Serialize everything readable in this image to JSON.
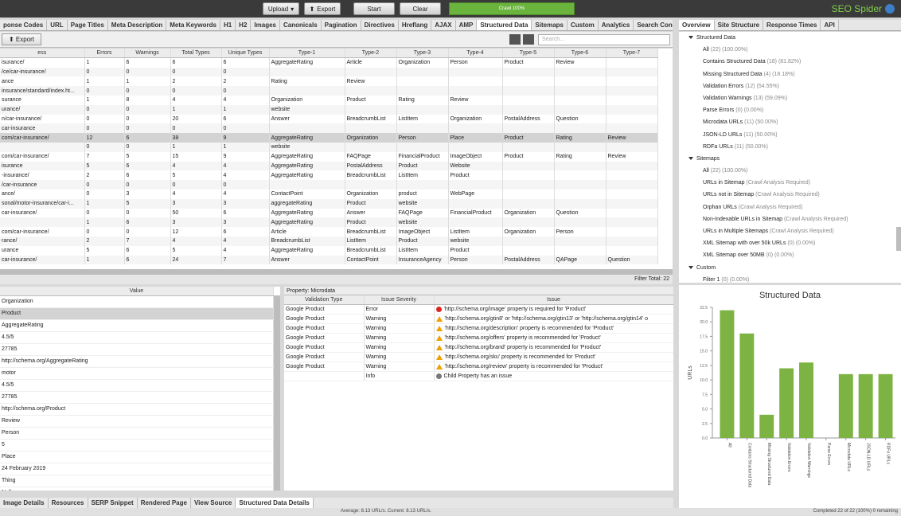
{
  "topbar": {
    "upload_label": "Upload",
    "export_label": "Export",
    "start_label": "Start",
    "clear_label": "Clear",
    "progress_text": "Crawl 100%",
    "progress_value": 100,
    "brand": "SEO Spider"
  },
  "top_tabs": [
    "ponse Codes",
    "URL",
    "Page Titles",
    "Meta Description",
    "Meta Keywords",
    "H1",
    "H2",
    "Images",
    "Canonicals",
    "Pagination",
    "Directives",
    "Hreflang",
    "AJAX",
    "AMP",
    "Structured Data",
    "Sitemaps",
    "Custom",
    "Analytics",
    "Search Con"
  ],
  "active_top_tab": "Structured Data",
  "toolbar": {
    "export_label": "Export",
    "search_placeholder": "Search..."
  },
  "grid": {
    "columns": [
      "ess",
      "Errors",
      "Warnings",
      "Total Types",
      "Unique Types",
      "Type-1",
      "Type-2",
      "Type-3",
      "Type-4",
      "Type-5",
      "Type-6",
      "Type-7"
    ],
    "rows": [
      [
        "isurance/",
        "1",
        "6",
        "6",
        "6",
        "AggregateRating",
        "Article",
        "Organization",
        "Person",
        "Product",
        "Review",
        ""
      ],
      [
        "/ce/car-insurance/",
        "0",
        "0",
        "0",
        "0",
        "",
        "",
        "",
        "",
        "",
        "",
        ""
      ],
      [
        "ance",
        "1",
        "1",
        "2",
        "2",
        "Rating",
        "Review",
        "",
        "",
        "",
        "",
        ""
      ],
      [
        "insurance/standard/index.ht...",
        "0",
        "0",
        "0",
        "0",
        "",
        "",
        "",
        "",
        "",
        "",
        ""
      ],
      [
        "surance",
        "1",
        "8",
        "4",
        "4",
        "Organization",
        "Product",
        "Rating",
        "Review",
        "",
        "",
        ""
      ],
      [
        "urance/",
        "0",
        "0",
        "1",
        "1",
        "website",
        "",
        "",
        "",
        "",
        "",
        ""
      ],
      [
        "n/car-insurance/",
        "0",
        "0",
        "20",
        "6",
        "Answer",
        "BreadcrumbList",
        "ListItem",
        "Organization",
        "PostalAddress",
        "Question",
        ""
      ],
      [
        "car-insurance",
        "0",
        "0",
        "0",
        "0",
        "",
        "",
        "",
        "",
        "",
        "",
        ""
      ],
      [
        "com/car-insurance/",
        "12",
        "6",
        "38",
        "9",
        "AggregateRating",
        "Organization",
        "Person",
        "Place",
        "Product",
        "Rating",
        "Review"
      ],
      [
        "",
        "0",
        "0",
        "1",
        "1",
        "website",
        "",
        "",
        "",
        "",
        "",
        ""
      ],
      [
        "com/car-insurance/",
        "7",
        "5",
        "15",
        "9",
        "AggregateRating",
        "FAQPage",
        "FinancialProduct",
        "ImageObject",
        "Product",
        "Rating",
        "Review"
      ],
      [
        "isurance",
        "5",
        "6",
        "4",
        "4",
        "AggregateRating",
        "PostalAddress",
        "Product",
        "Website",
        "",
        "",
        ""
      ],
      [
        "-insurance/",
        "2",
        "6",
        "5",
        "4",
        "AggregateRating",
        "BreadcrumbList",
        "ListItem",
        "Product",
        "",
        "",
        ""
      ],
      [
        "/car-insurance",
        "0",
        "0",
        "0",
        "0",
        "",
        "",
        "",
        "",
        "",
        "",
        ""
      ],
      [
        "ance/",
        "0",
        "3",
        "4",
        "4",
        "ContactPoint",
        "Organization",
        "product",
        "WebPage",
        "",
        "",
        ""
      ],
      [
        "sonal/motor-insurance/car-i...",
        "1",
        "5",
        "3",
        "3",
        "aggregateRating",
        "Product",
        "website",
        "",
        "",
        "",
        ""
      ],
      [
        "car-insurance/",
        "0",
        "0",
        "50",
        "6",
        "AggregateRating",
        "Answer",
        "FAQPage",
        "FinancialProduct",
        "Organization",
        "Question",
        ""
      ],
      [
        "",
        "1",
        "6",
        "3",
        "3",
        "AggregateRating",
        "Product",
        "website",
        "",
        "",
        "",
        ""
      ],
      [
        "com/car-insurance/",
        "0",
        "0",
        "12",
        "6",
        "Article",
        "BreadcrumbList",
        "ImageObject",
        "ListItem",
        "Organization",
        "Person",
        ""
      ],
      [
        "rance/",
        "2",
        "7",
        "4",
        "4",
        "BreadcrumbList",
        "ListItem",
        "Product",
        "website",
        "",
        "",
        ""
      ],
      [
        "urance",
        "5",
        "6",
        "5",
        "4",
        "AggregateRating",
        "BreadcrumbList",
        "ListItem",
        "Product",
        "",
        "",
        ""
      ],
      [
        "car-insurance/",
        "1",
        "6",
        "24",
        "7",
        "Answer",
        "ContactPoint",
        "InsuranceAgency",
        "Person",
        "PostalAddress",
        "QAPage",
        "Question"
      ]
    ],
    "selected_row": 8,
    "filter_total": "Filter Total:  22"
  },
  "details": {
    "header": "Value",
    "values": [
      "Organization",
      "Product",
      "AggregateRating",
      "4.5/5",
      "27785",
      "http://schema.org/AggregateRating",
      "motor",
      "4.5/5",
      "27785",
      "http://schema.org/Product",
      "Review",
      "Person",
      "5",
      "Place",
      "24 February 2019",
      "Thing",
      "Null"
    ],
    "selected_index": 1
  },
  "validation": {
    "header": "Property: Microdata",
    "columns": [
      "Validation Type",
      "Issue Severity",
      "Issue"
    ],
    "rows": [
      {
        "type": "Google Product",
        "severity": "Error",
        "issue": "'http://schema.org/image' property is required for 'Product'"
      },
      {
        "type": "Google Product",
        "severity": "Warning",
        "issue": "'http://schema.org/gtin8' or 'http://schema.org/gtin13' or 'http://schema.org/gtin14' o"
      },
      {
        "type": "Google Product",
        "severity": "Warning",
        "issue": "'http://schema.org/description' property is recommended for 'Product'"
      },
      {
        "type": "Google Product",
        "severity": "Warning",
        "issue": "'http://schema.org/offers' property is recommended for 'Product'"
      },
      {
        "type": "Google Product",
        "severity": "Warning",
        "issue": "'http://schema.org/brand' property is recommended for 'Product'"
      },
      {
        "type": "Google Product",
        "severity": "Warning",
        "issue": "'http://schema.org/sku' property is recommended for 'Product'"
      },
      {
        "type": "Google Product",
        "severity": "Warning",
        "issue": "'http://schema.org/review' property is recommended for 'Product'"
      },
      {
        "type": "",
        "severity": "Info",
        "issue": "Child Property has an issue"
      }
    ]
  },
  "bottom_tabs": [
    "Image Details",
    "Resources",
    "SERP Snippet",
    "Rendered Page",
    "View Source",
    "Structured Data Details"
  ],
  "active_bottom_tab": "Structured Data Details",
  "status": {
    "middle": "Average: 8.13 URL/s. Current: 8.13 URL/s.",
    "right": "Completed 22 of 22 (100%) 0 remaining"
  },
  "right_tabs": [
    "Overview",
    "Site Structure",
    "Response Times",
    "API"
  ],
  "active_right_tab": "Overview",
  "tree": [
    {
      "kind": "group",
      "label": "Structured Data"
    },
    {
      "kind": "child",
      "label": "All",
      "count": "(22) (100.00%)"
    },
    {
      "kind": "child",
      "label": "Contains Structured Data",
      "count": "(18) (81.82%)"
    },
    {
      "kind": "child",
      "label": "Missing Structured Data",
      "count": "(4) (18.18%)"
    },
    {
      "kind": "child",
      "label": "Validation Errors",
      "count": "(12) (54.55%)"
    },
    {
      "kind": "child",
      "label": "Validation Warnings",
      "count": "(13) (59.09%)"
    },
    {
      "kind": "child",
      "label": "Parse Errors",
      "count": "(0) (0.00%)"
    },
    {
      "kind": "child",
      "label": "Microdata URLs",
      "count": "(11) (50.00%)"
    },
    {
      "kind": "child",
      "label": "JSON-LD URLs",
      "count": "(11) (50.00%)"
    },
    {
      "kind": "child",
      "label": "RDFa URLs",
      "count": "(11) (50.00%)"
    },
    {
      "kind": "group",
      "label": "Sitemaps"
    },
    {
      "kind": "child",
      "label": "All",
      "count": "(22) (100.00%)"
    },
    {
      "kind": "child",
      "label": "URLs in Sitemap",
      "count": "(Crawl Analysis Required)"
    },
    {
      "kind": "child",
      "label": "URLs not in Sitemap",
      "count": "(Crawl Analysis Required)"
    },
    {
      "kind": "child",
      "label": "Orphan URLs",
      "count": "(Crawl Analysis Required)"
    },
    {
      "kind": "child",
      "label": "Non-Indexable URLs in Sitemap",
      "count": "(Crawl Analysis Required)"
    },
    {
      "kind": "child",
      "label": "URLs in Multiple Sitemaps",
      "count": "(Crawl Analysis Required)"
    },
    {
      "kind": "child",
      "label": "XML Sitemap with over 50k URLs",
      "count": "(0) (0.00%)"
    },
    {
      "kind": "child",
      "label": "XML Sitemap over 50MB",
      "count": "(0) (0.00%)"
    },
    {
      "kind": "group",
      "label": "Custom"
    },
    {
      "kind": "child",
      "label": "Filter 1",
      "count": "(0) (0.00%)"
    }
  ],
  "chart_data": {
    "type": "bar",
    "title": "Structured Data",
    "ylabel": "URLs",
    "xlabel": "",
    "categories": [
      "All",
      "Contains Structured Data",
      "Missing Structured Data",
      "Validation Errors",
      "Validation Warnings",
      "Parse Errors",
      "Microdata URLs",
      "JSON-LD URLs",
      "RDFa URLs"
    ],
    "values": [
      22,
      18,
      4,
      12,
      13,
      0,
      11,
      11,
      11
    ],
    "ylim": [
      0,
      22.5
    ],
    "yticks": [
      "0.0",
      "2.5",
      "5.0",
      "7.5",
      "10.0",
      "12.5",
      "15.0",
      "17.5",
      "20.0",
      "22.5"
    ],
    "color": "#7cb342"
  },
  "colors": {
    "accent": "#6ab43e",
    "topbar": "#3a3a3a",
    "brand": "#7fcf4a"
  }
}
